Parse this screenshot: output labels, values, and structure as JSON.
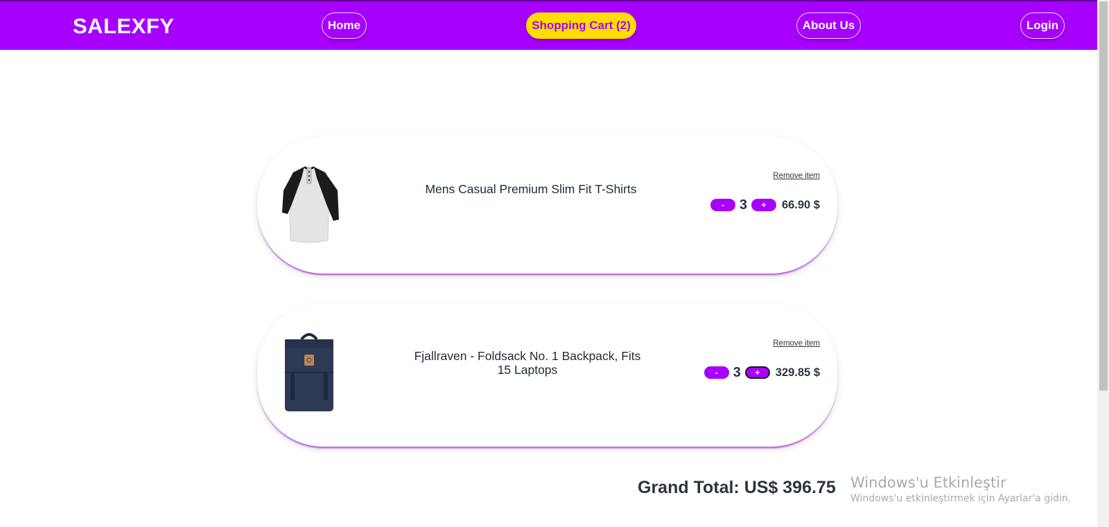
{
  "nav": {
    "brand": "SALEXFY",
    "home": "Home",
    "cart": "Shopping Cart (2)",
    "about": "About Us",
    "login": "Login"
  },
  "cart": {
    "items": [
      {
        "name": "Mens Casual Premium Slim Fit T-Shirts",
        "remove": "Remove item",
        "minus": "-",
        "qty": "3",
        "plus": "+",
        "price": "66.90 $",
        "image": "tshirt-image"
      },
      {
        "name": "Fjallraven - Foldsack No. 1 Backpack, Fits 15 Laptops",
        "remove": "Remove item",
        "minus": "-",
        "qty": "3",
        "plus": "+",
        "price": "329.85 $",
        "image": "backpack-image"
      }
    ],
    "grand_total": "Grand Total: US$ 396.75"
  },
  "watermark": {
    "title": "Windows'u Etkinleştir",
    "subtitle": "Windows'u etkinleştirmek için Ayarlar'a gidin."
  },
  "colors": {
    "brand_purple": "#a700ff",
    "cart_yellow": "#ffdd00",
    "text_dark": "#2b3440"
  }
}
